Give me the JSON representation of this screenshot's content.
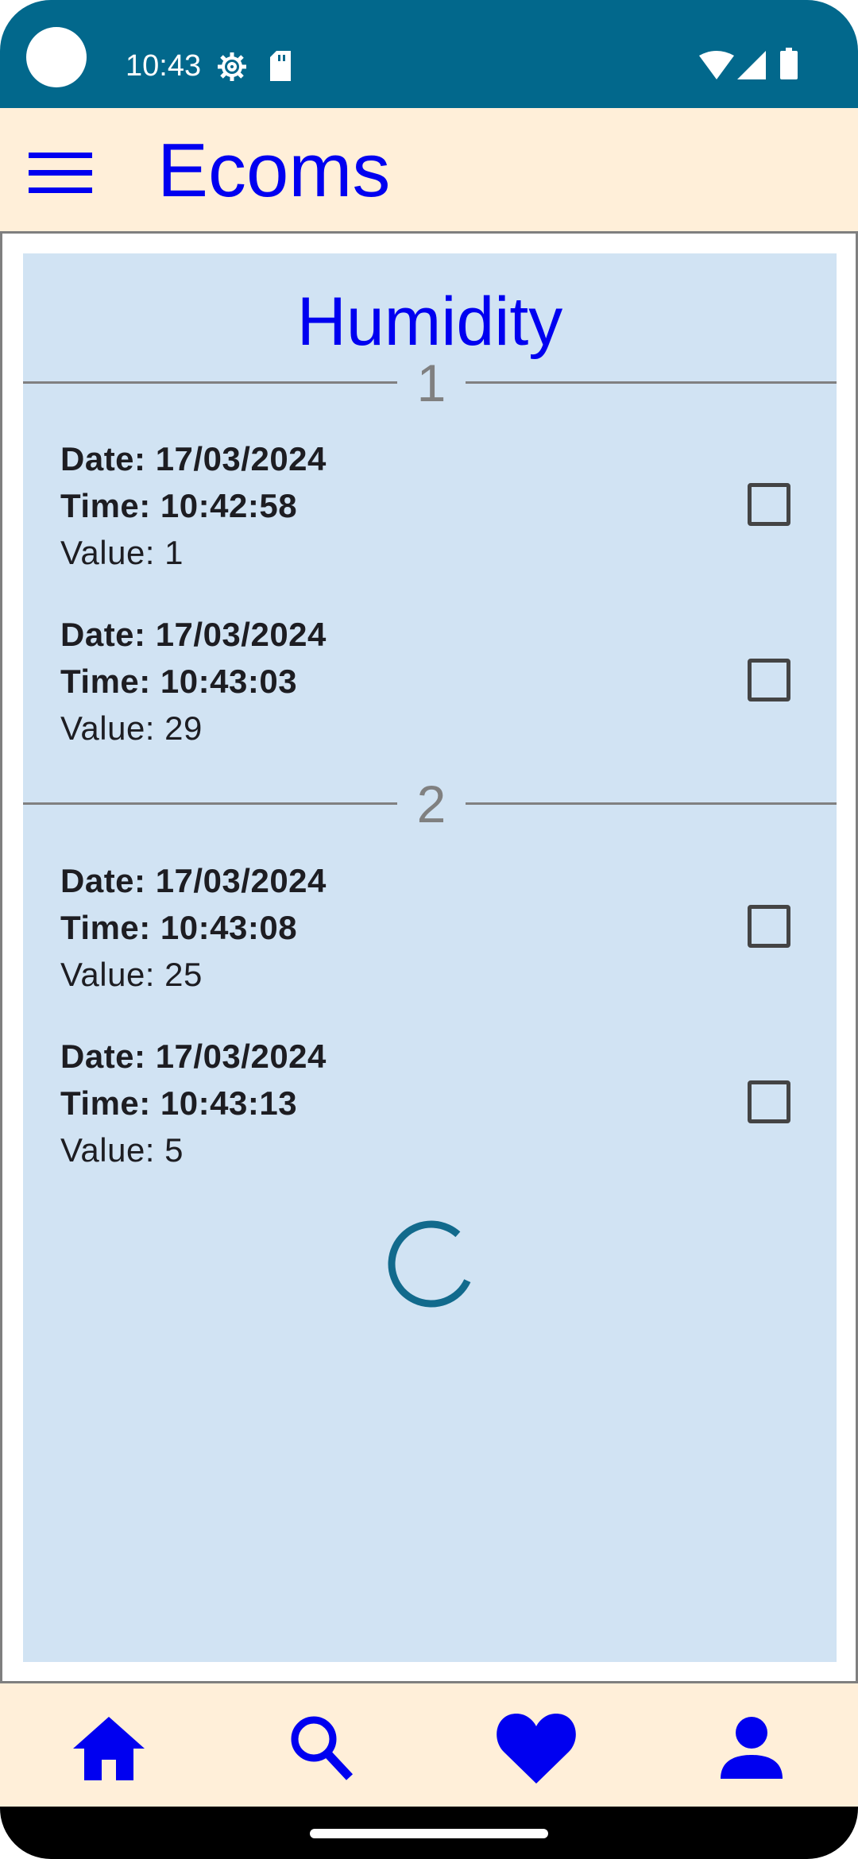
{
  "status_bar": {
    "time": "10:43",
    "icons": [
      "settings-gear-icon",
      "sd-card-icon",
      "wifi-icon",
      "cellular-signal-icon",
      "battery-icon"
    ]
  },
  "app_bar": {
    "title": "Ecoms",
    "menu_icon": "hamburger-menu-icon"
  },
  "panel": {
    "title": "Humidity",
    "groups": [
      {
        "number": "1",
        "entries": [
          {
            "date": "Date: 17/03/2024",
            "time": "Time: 10:42:58",
            "value": "Value: 1",
            "checked": false
          },
          {
            "date": "Date: 17/03/2024",
            "time": "Time: 10:43:03",
            "value": "Value: 29",
            "checked": false
          }
        ]
      },
      {
        "number": "2",
        "entries": [
          {
            "date": "Date: 17/03/2024",
            "time": "Time: 10:43:08",
            "value": "Value: 25",
            "checked": false
          },
          {
            "date": "Date: 17/03/2024",
            "time": "Time: 10:43:13",
            "value": "Value: 5",
            "checked": false
          }
        ]
      }
    ],
    "loading": true
  },
  "bottom_nav": {
    "items": [
      {
        "icon": "home-icon"
      },
      {
        "icon": "search-icon"
      },
      {
        "icon": "heart-icon"
      },
      {
        "icon": "person-icon"
      }
    ]
  },
  "colors": {
    "status_bar": "#02688c",
    "app_bar": "#ffefd9",
    "accent": "#0000f0",
    "panel": "#d1e3f3",
    "spinner": "#126a8c"
  }
}
